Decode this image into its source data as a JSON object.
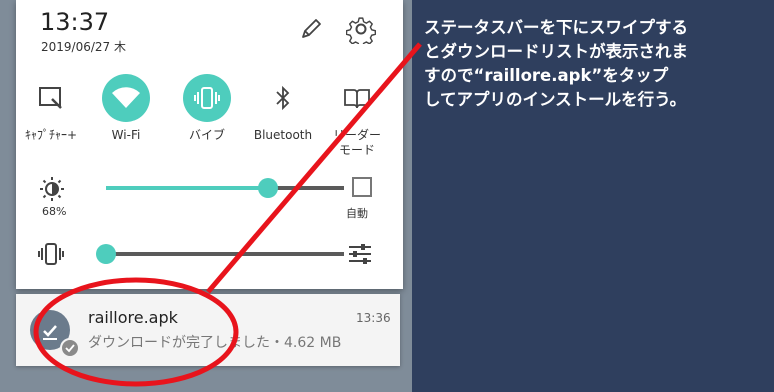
{
  "status": {
    "time": "13:37",
    "date": "2019/06/27 木"
  },
  "tiles": [
    {
      "label": "ｷｬﾌﾟﾁｬｰ+",
      "icon": "capture-icon"
    },
    {
      "label": "Wi-Fi",
      "icon": "wifi-icon"
    },
    {
      "label": "バイブ",
      "icon": "vibrate-icon"
    },
    {
      "label": "Bluetooth",
      "icon": "bluetooth-icon"
    },
    {
      "label1": "リーダー",
      "label2": "モード",
      "icon": "reader-mode-icon"
    }
  ],
  "brightness": {
    "percent_label": "68%",
    "level": 0.68,
    "auto_label": "自動"
  },
  "volume": {
    "level": 0.0
  },
  "notification": {
    "title": "raillore.apk",
    "subtitle": "ダウンロードが完了しました・4.62 MB",
    "time": "13:36"
  },
  "callout": {
    "line1": "ステータスバーを下にスワイプする",
    "line2": "とダウンロードリストが表示されま",
    "line3": "すので“raillore.apk”をタップ",
    "line4": "してアプリのインストールを行う。"
  },
  "colors": {
    "accent": "#4ecdbd",
    "annotation_red": "#e8141c",
    "background": "#2f3f5e"
  }
}
